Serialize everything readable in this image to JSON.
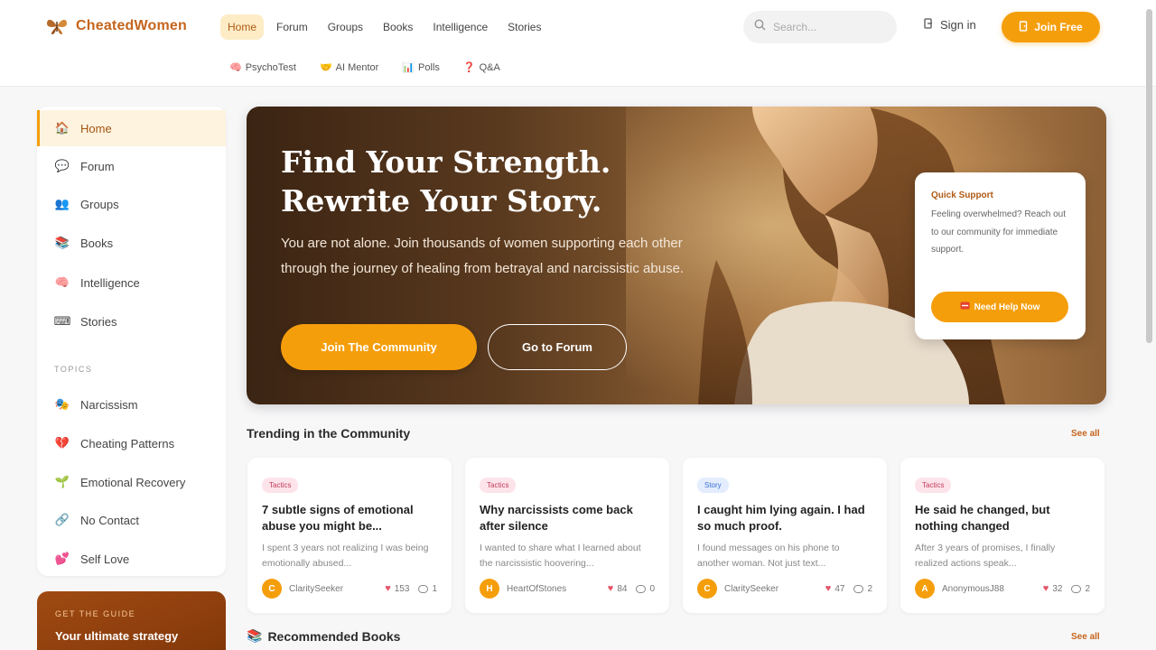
{
  "brand": {
    "name": "CheatedWomen"
  },
  "nav": [
    "Home",
    "Forum",
    "Groups",
    "Books",
    "Intelligence",
    "Stories"
  ],
  "subnav": [
    {
      "emoji": "🧠",
      "label": "PsychoTest"
    },
    {
      "emoji": "🤝",
      "label": "AI Mentor"
    },
    {
      "emoji": "📊",
      "label": "Polls"
    },
    {
      "emoji": "❓",
      "label": "Q&A"
    }
  ],
  "search": {
    "placeholder": "Search..."
  },
  "header": {
    "signin": "Sign in",
    "join": "Join Free"
  },
  "sidebar": {
    "main": [
      {
        "label": "Home",
        "emoji": "🏠"
      },
      {
        "label": "Forum",
        "emoji": "💬"
      },
      {
        "label": "Groups",
        "emoji": "👥"
      },
      {
        "label": "Books",
        "emoji": "📚"
      },
      {
        "label": "Intelligence",
        "emoji": "🧠"
      },
      {
        "label": "Stories",
        "emoji": "⌨"
      }
    ],
    "section": "TOPICS",
    "topics": [
      {
        "label": "Narcissism",
        "emoji": "🎭"
      },
      {
        "label": "Cheating Patterns",
        "emoji": "💔"
      },
      {
        "label": "Emotional Recovery",
        "emoji": "🌱"
      },
      {
        "label": "No Contact",
        "emoji": "🔗"
      },
      {
        "label": "Self Love",
        "emoji": "💕"
      }
    ]
  },
  "guide": {
    "kicker": "GET THE GUIDE",
    "title": "Your ultimate strategy"
  },
  "hero": {
    "title_line1": "Find Your Strength.",
    "title_line2": "Rewrite Your Story.",
    "text": "You are not alone. Join thousands of women supporting each other through the journey of healing from betrayal and narcissistic abuse.",
    "primary": "Join The Community",
    "secondary": "Go to Forum"
  },
  "support": {
    "title": "Quick Support",
    "text": "Feeling overwhelmed? Reach out to our community for immediate support.",
    "button": "Need Help Now"
  },
  "trending": {
    "title": "Trending in the Community",
    "see_all": "See all",
    "cards": [
      {
        "tag": "Tactics",
        "title": "7 subtle signs of emotional abuse you might be...",
        "excerpt": "I spent 3 years not realizing I was being emotionally abused...",
        "author": "ClaritySeeker",
        "initial": "C",
        "likes": "153",
        "comments": "1"
      },
      {
        "tag": "Tactics",
        "title": "Why narcissists come back after silence",
        "excerpt": "I wanted to share what I learned about the narcissistic hoovering...",
        "author": "HeartOfStones",
        "initial": "H",
        "likes": "84",
        "comments": "0"
      },
      {
        "tag": "Story",
        "title": "I caught him lying again. I had so much proof.",
        "excerpt": "I found messages on his phone to another woman. Not just text...",
        "author": "ClaritySeeker",
        "initial": "C",
        "likes": "47",
        "comments": "2"
      },
      {
        "tag": "Tactics",
        "title": "He said he changed, but nothing changed",
        "excerpt": "After 3 years of promises, I finally realized actions speak...",
        "author": "AnonymousJ88",
        "initial": "A",
        "likes": "32",
        "comments": "2"
      }
    ]
  },
  "books": {
    "title": "Recommended Books",
    "emoji": "📚",
    "see_all": "See all"
  },
  "colors": {
    "accent": "#f59e0b",
    "brand": "#c5651d",
    "active_bg": "#fdecc6"
  }
}
